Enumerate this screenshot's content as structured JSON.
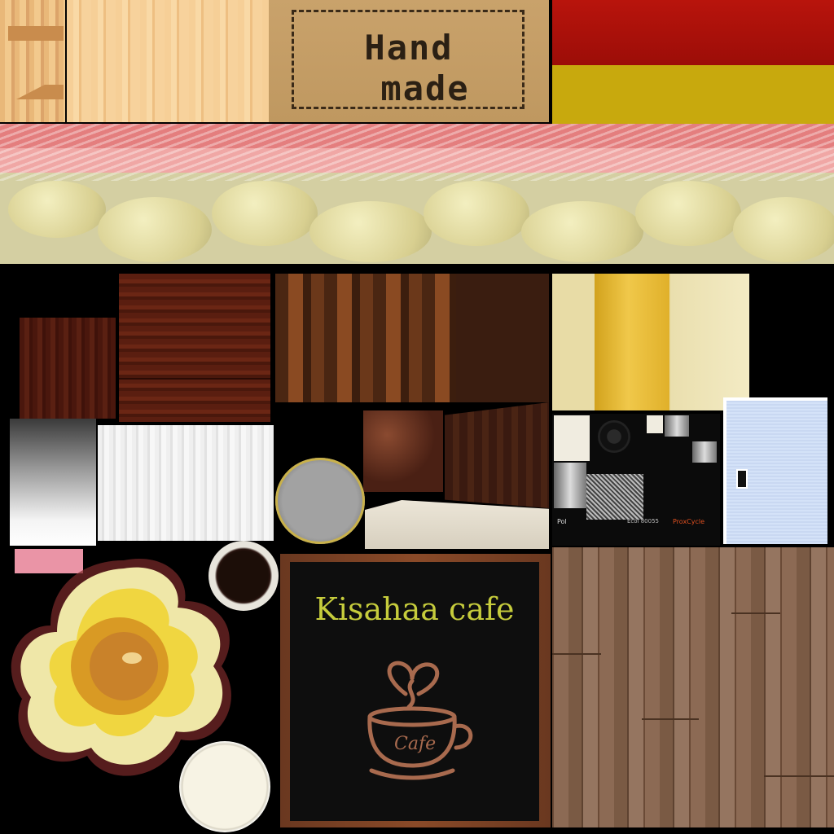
{
  "handmade_label": {
    "line1": "Hand",
    "line2": "made"
  },
  "cafe_sign": {
    "title": "Kisahaa cafe",
    "cup_text": "Cafe"
  },
  "coffee_machine": {
    "brand_left": "Pol",
    "model": "Ecol 80055",
    "brand_right": "ProxCycle"
  },
  "colors": {
    "flag_red": "#b8140c",
    "flag_yellow": "#c8a90d",
    "sign_text": "#c6cc3c",
    "sign_logo": "#a86a4e",
    "pink_swatch": "#ea94a6"
  }
}
